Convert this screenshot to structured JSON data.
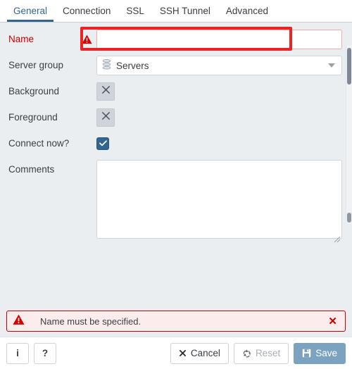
{
  "dialog": {
    "tabs": [
      {
        "label": "General",
        "active": true
      },
      {
        "label": "Connection",
        "active": false
      },
      {
        "label": "SSL",
        "active": false
      },
      {
        "label": "SSH Tunnel",
        "active": false
      },
      {
        "label": "Advanced",
        "active": false
      }
    ],
    "fields": {
      "name": {
        "label": "Name",
        "value": "",
        "placeholder": "",
        "invalid": true
      },
      "server_group": {
        "label": "Server group",
        "value": "Servers",
        "icon": "server-stack-icon"
      },
      "background": {
        "label": "Background",
        "swatch_icon": "x-icon",
        "value": ""
      },
      "foreground": {
        "label": "Foreground",
        "swatch_icon": "x-icon",
        "value": ""
      },
      "connect_now": {
        "label": "Connect now?",
        "checked": true
      },
      "comments": {
        "label": "Comments",
        "value": "",
        "placeholder": ""
      }
    },
    "alert": {
      "icon": "warning-triangle-icon",
      "message": "Name must be specified.",
      "close_label": "✕"
    },
    "footer": {
      "info_label": "i",
      "help_label": "?",
      "cancel_label": "Cancel",
      "reset_label": "Reset",
      "save_label": "Save",
      "reset_disabled": true,
      "save_disabled": true
    }
  },
  "colors": {
    "accent": "#326690",
    "error": "#cc0000",
    "annotation": "#ee2222",
    "body_bg": "#ebeef1",
    "panel_bg": "#ffffff",
    "swatch": "#ced4da",
    "save_bg": "#7ba3bf"
  }
}
